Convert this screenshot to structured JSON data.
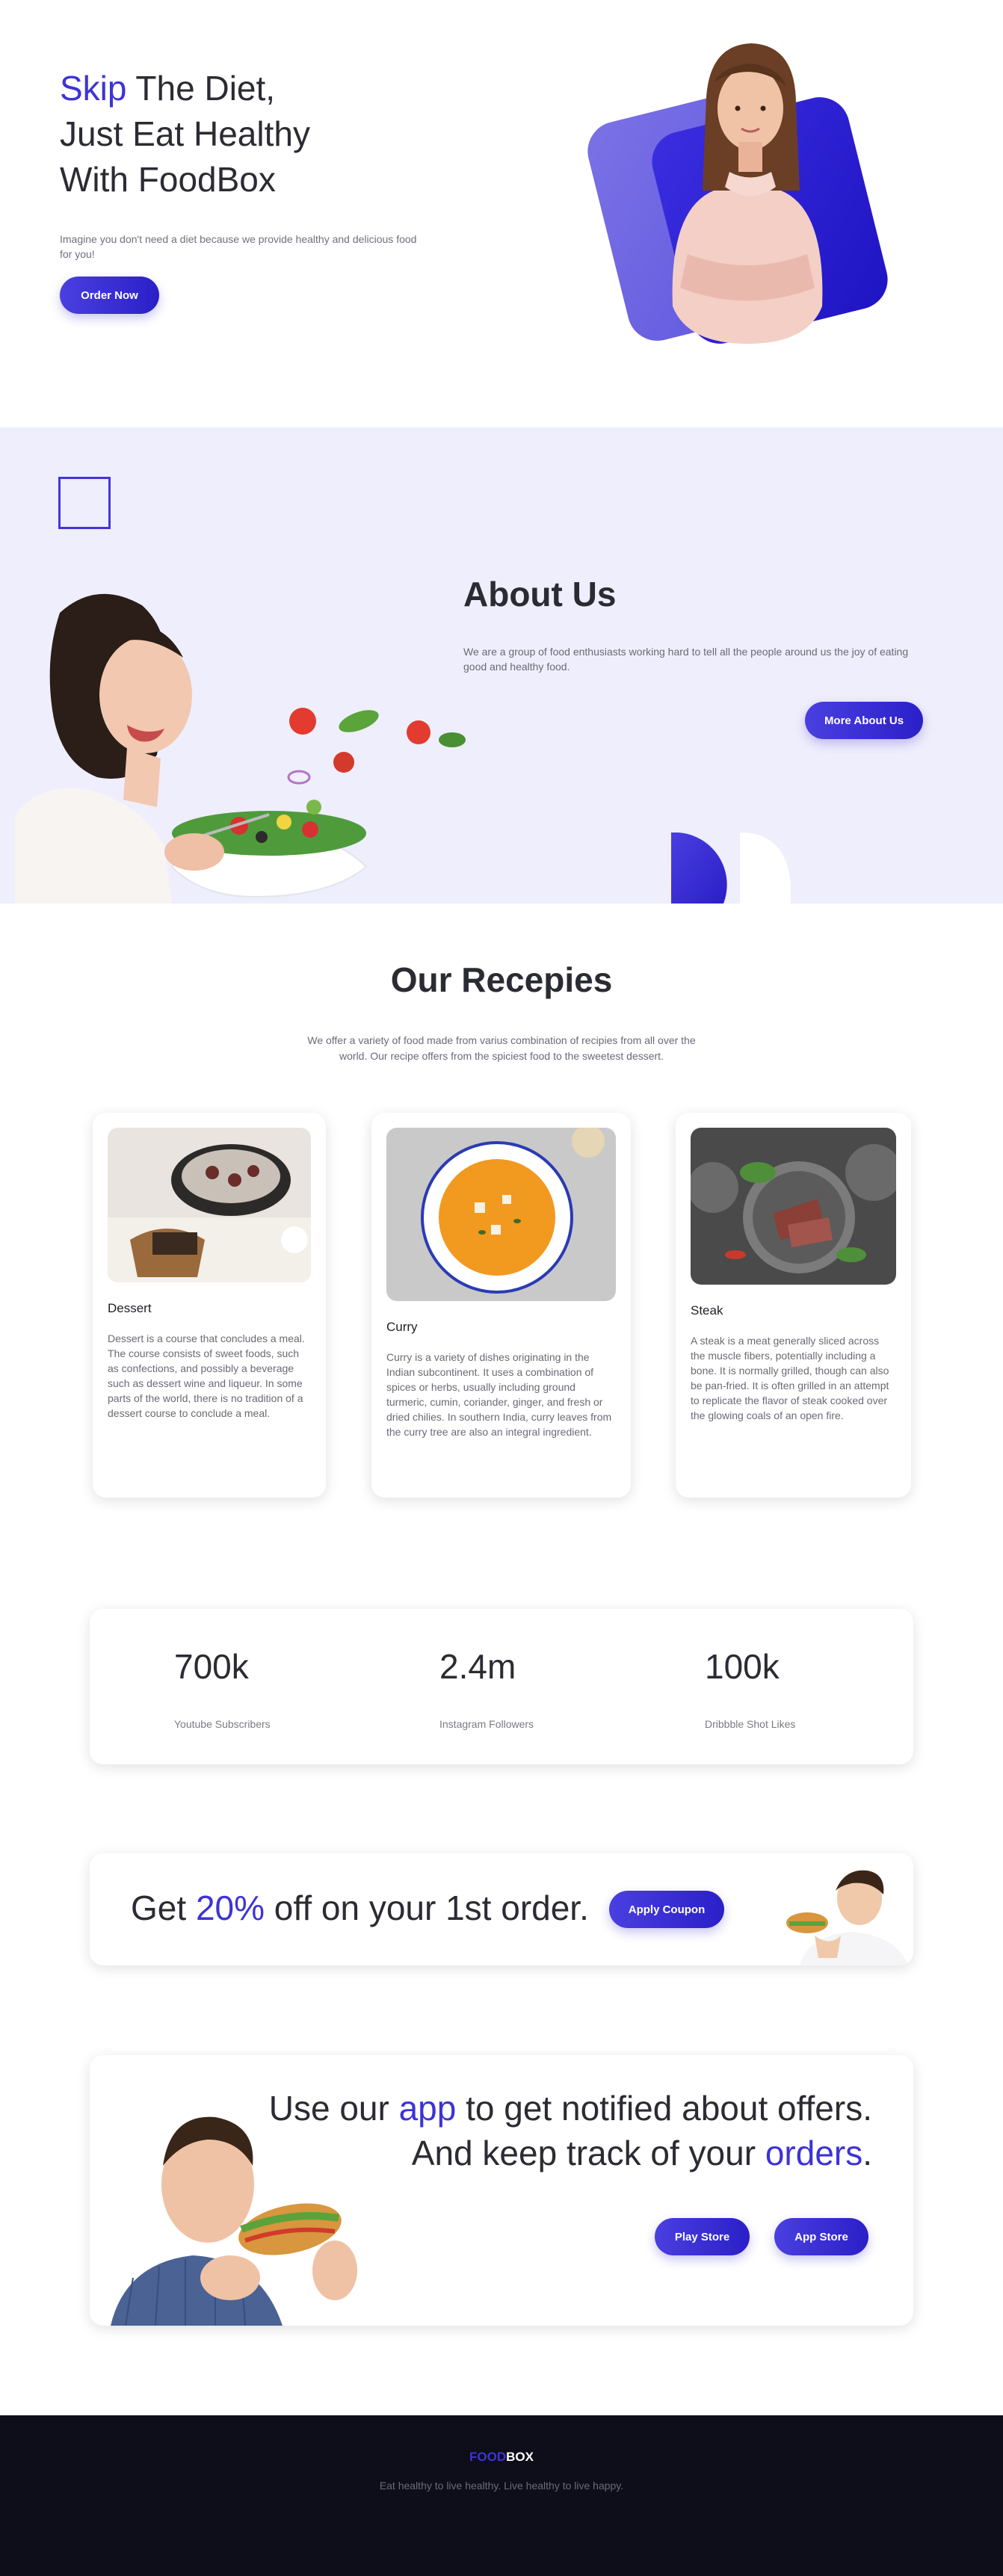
{
  "hero": {
    "title_accent": "Skip",
    "title_line1_rest": " The Diet,",
    "title_line2": "Just Eat Healthy",
    "title_line3": "With FoodBox",
    "subtitle": "Imagine you don't need a diet because we provide healthy and delicious food for you!",
    "cta_label": "Order Now"
  },
  "about": {
    "title": "About Us",
    "text": "We are a group of food enthusiasts working hard to tell all the people around us the joy of eating good and healthy food.",
    "cta_label": "More About Us"
  },
  "recipes": {
    "title": "Our Recepies",
    "subtitle": "We offer a variety of food made from varius combination of recipies from all over the world. Our recipe offers from the spiciest food to the sweetest dessert.",
    "cards": [
      {
        "title": "Dessert",
        "text": "Dessert is a course that concludes a meal. The course consists of sweet foods, such as confections, and possibly a beverage such as dessert wine and liqueur. In some parts of the world, there is no tradition of a dessert course to conclude a meal."
      },
      {
        "title": "Curry",
        "text": "Curry is a variety of dishes originating in the Indian subcontinent. It uses a combination of spices or herbs, usually including ground turmeric, cumin, coriander, ginger, and fresh or dried chilies. In southern India, curry leaves from the curry tree are also an integral ingredient."
      },
      {
        "title": "Steak",
        "text": "A steak is a meat generally sliced across the muscle fibers, potentially including a bone. It is normally grilled, though can also be pan-fried. It is often grilled in an attempt to replicate the flavor of steak cooked over the glowing coals of an open fire."
      }
    ]
  },
  "stats": [
    {
      "value": "700k",
      "label": "Youtube Subscribers"
    },
    {
      "value": "2.4m",
      "label": "Instagram Followers"
    },
    {
      "value": "100k",
      "label": "Dribbble Shot Likes"
    }
  ],
  "coupon": {
    "text_before": "Get ",
    "text_accent": "20%",
    "text_after": " off on your 1st order.",
    "cta_label": "Apply Coupon"
  },
  "app_promo": {
    "line1_before": "Use our ",
    "line1_accent": "app",
    "line1_after": " to get notified about offers.",
    "line2_before": "And keep track of your ",
    "line2_accent": "orders",
    "line2_after": ".",
    "play_label": "Play Store",
    "app_label": "App Store"
  },
  "footer": {
    "brand_accent": "FOOD",
    "brand_rest": "BOX",
    "tagline": "Eat healthy to live healthy. Live healthy to live happy."
  },
  "colors": {
    "accent": "#3d33d6",
    "button_gradient_start": "#4a3fe0",
    "button_gradient_end": "#2b1fc8",
    "about_background": "#efeefc",
    "footer_background": "#0e0e1a"
  },
  "icons": {
    "hero": "woman-portrait-illustration",
    "about": "woman-eating-salad-illustration",
    "coupon": "man-with-burger-illustration",
    "app": "man-eating-sandwich-illustration"
  }
}
